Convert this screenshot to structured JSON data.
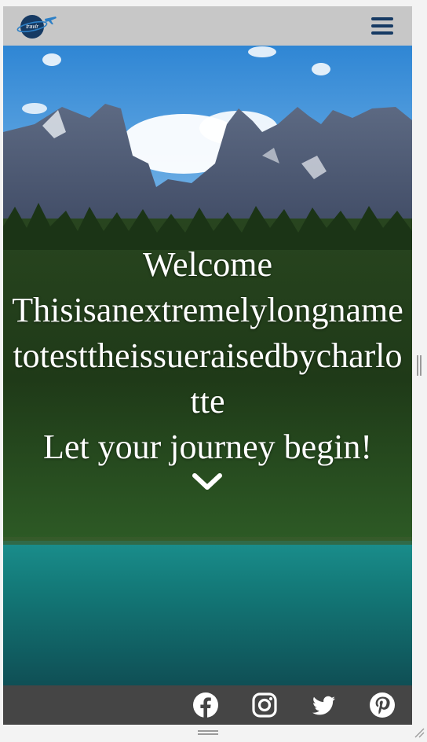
{
  "app": {
    "logo_text": "travlr",
    "logo_icon": "airplane-globe-logo",
    "menu_icon": "hamburger-menu-icon"
  },
  "hero": {
    "line1": "Welcome",
    "line2": "Thisisanextremelylongnametotesttheissueraisedbycharlotte",
    "line3": "Let your journey begin!",
    "scroll_icon": "chevron-down-icon"
  },
  "footer": {
    "social": [
      {
        "name": "Facebook",
        "icon": "facebook-icon"
      },
      {
        "name": "Instagram",
        "icon": "instagram-icon"
      },
      {
        "name": "Twitter",
        "icon": "twitter-icon"
      },
      {
        "name": "Pinterest",
        "icon": "pinterest-icon"
      }
    ]
  },
  "colors": {
    "topbar": "#c7c7c7",
    "footer": "#454545",
    "brand": "#163a63",
    "hero_text": "#ffffff"
  }
}
